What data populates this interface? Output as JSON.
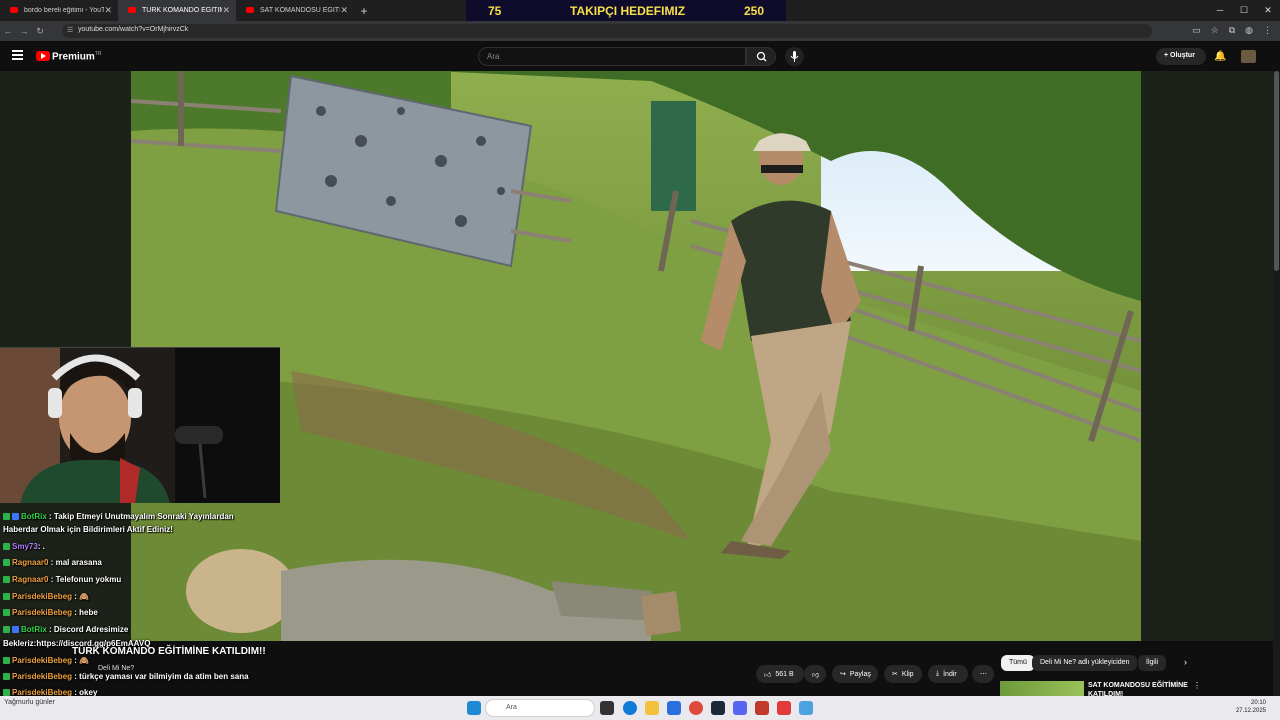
{
  "browser": {
    "tabs": [
      {
        "label": "bordo bereli eğitimi - YouTube",
        "active": false
      },
      {
        "label": "TÜRK KOMANDO EĞİTİMİ",
        "active": true
      },
      {
        "label": "SAT KOMANDOSU EĞİTİMİNE",
        "active": false
      }
    ],
    "url": "youtube.com/watch?v=OrMjhirvzCk"
  },
  "follow_goal": {
    "current": "75",
    "label": "TAKIPÇI HEDEFIMIZ",
    "goal": "250"
  },
  "youtube": {
    "brand": "Premium",
    "brand_sup": "TR",
    "search_placeholder": "Ara",
    "create_label": "Oluştur",
    "video_title": "TÜRK KOMANDO EĞİTİMİNE KATILDIM!!",
    "channel": "Deli Mi Ne?",
    "like_count": "561 B",
    "share_label": "Paylaş",
    "clip_label": "Klip",
    "download_label": "İndir",
    "chips": [
      "Tümü",
      "Deli Mi Ne? adlı yükleyiciden",
      "İlgili"
    ],
    "related_title": "SAT KOMANDOSU EĞİTİMİNE KATILDIM!"
  },
  "chat": [
    {
      "user": "BotRix",
      "text": ": Takip Etmeyi Unutmayalım Sonraki Yayınlardan",
      "color": "green"
    },
    {
      "user": "",
      "text": "Haberdar Olmak için Bildirimleri Aktif Ediniz!",
      "color": "green"
    },
    {
      "user": "Smy73",
      "text": ": .",
      "color": "purple"
    },
    {
      "user": "Ragnaar0",
      "text": ": mal arasana",
      "color": "orange"
    },
    {
      "user": "Ragnaar0",
      "text": ": Telefonun yokmu",
      "color": "orange"
    },
    {
      "user": "ParisdekiBebeg",
      "text": ": 🙈",
      "color": "orange"
    },
    {
      "user": "ParisdekiBebeg",
      "text": ": hebe",
      "color": "orange"
    },
    {
      "user": "BotRix",
      "text": ": Discord Adresimize",
      "color": "green"
    },
    {
      "user": "",
      "text": "Bekleriz:https://discord.gg/p6EmAAVQ",
      "color": "green"
    },
    {
      "user": "ParisdekiBebeg",
      "text": ": 🙈",
      "color": "orange"
    },
    {
      "user": "ParisdekiBebeg",
      "text": ": türkçe yaması var bilmiyim da atim ben sana",
      "color": "orange"
    },
    {
      "user": "ParisdekiBebeg",
      "text": ": okey",
      "color": "orange"
    }
  ],
  "taskbar": {
    "left_label": "Yağmurlu günler",
    "search_placeholder": "Ara",
    "time": "20:10",
    "date": "27.12.2025"
  }
}
